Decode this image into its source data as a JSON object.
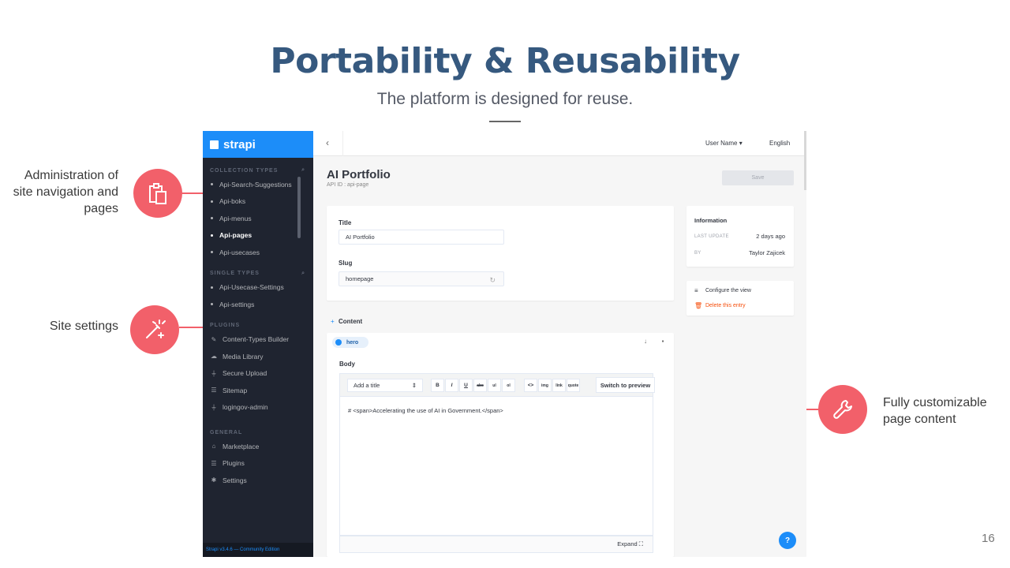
{
  "slide": {
    "title": "Portability & Reusability",
    "subtitle": "The platform is designed for reuse.",
    "page_number": "16"
  },
  "callouts": {
    "admin": [
      "Administration of",
      "site navigation and",
      "pages"
    ],
    "settings": "Site settings",
    "content": [
      "Fully customizable",
      "page content"
    ],
    "icons": [
      "clipboard-icon",
      "magic-wand-icon",
      "wrench-icon"
    ],
    "color": "#f2606a"
  },
  "app": {
    "brand": "strapi",
    "sections": {
      "collection": "COLLECTION TYPES",
      "single": "SINGLE TYPES",
      "plugins": "PLUGINS",
      "general": "GENERAL"
    },
    "collection_items": [
      "Api-Search-Suggestions",
      "Api-boks",
      "Api-menus",
      "Api-pages",
      "Api-usecases"
    ],
    "single_items": [
      "Api-Usecase-Settings",
      "Api-settings"
    ],
    "plugin_items": [
      {
        "label": "Content-Types Builder",
        "icon": "pencil-icon"
      },
      {
        "label": "Media Library",
        "icon": "cloud-icon"
      },
      {
        "label": "Secure Upload",
        "icon": "plug-icon"
      },
      {
        "label": "Sitemap",
        "icon": "list-icon"
      },
      {
        "label": "logingov-admin",
        "icon": "plug-icon"
      }
    ],
    "general_items": [
      {
        "label": "Marketplace",
        "icon": "shop-icon"
      },
      {
        "label": "Plugins",
        "icon": "list-icon"
      },
      {
        "label": "Settings",
        "icon": "gear-icon"
      }
    ],
    "footer": "Strapi v3.4.6 — Community Edition",
    "topbar": {
      "user": "User Name",
      "language": "English"
    },
    "page_title": "AI Portfolio",
    "api_id": "API ID : api-page",
    "save": "Save",
    "fields": {
      "title_label": "Title",
      "title_value": "AI Portfolio",
      "slug_label": "Slug",
      "slug_value": "homepage"
    },
    "info": {
      "heading": "Information",
      "last_update_key": "LAST UPDATE",
      "last_update_val": "2 days ago",
      "by_key": "BY",
      "by_val": "Taylor Zajicek",
      "configure": "Configure the view",
      "delete": "Delete this entry"
    },
    "content": {
      "label": "Content",
      "component": "hero",
      "body_label": "Body",
      "select": "Add a title",
      "toolbar": [
        "B",
        "I",
        "U",
        "abc",
        "ul",
        "ol",
        "<>",
        "img",
        "link",
        "quote"
      ],
      "preview": "Switch to preview",
      "text": "# <span>Accelerating the use of AI in Government.</span>",
      "expand": "Expand"
    },
    "accent": "#1c8df9",
    "sidebar_bg": "#1f2430"
  }
}
